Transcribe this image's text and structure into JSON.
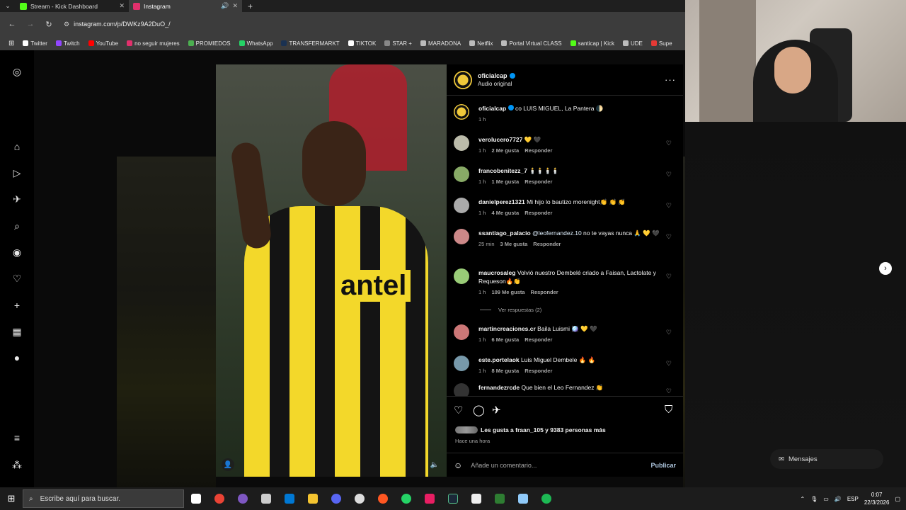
{
  "browser": {
    "tabs": [
      {
        "title": "Stream - Kick Dashboard",
        "color": "#53fc18"
      },
      {
        "title": "Instagram",
        "color": "#e1306c"
      }
    ],
    "url": "instagram.com/p/DWKz9A2DuO_/",
    "bookmarks": [
      {
        "label": "Twitter",
        "color": "#ffffff"
      },
      {
        "label": "Twitch",
        "color": "#9146ff"
      },
      {
        "label": "YouTube",
        "color": "#ff0000"
      },
      {
        "label": "no seguir mujeres",
        "color": "#e1306c"
      },
      {
        "label": "PROMIEDOS",
        "color": "#4caf50"
      },
      {
        "label": "WhatsApp",
        "color": "#25d366"
      },
      {
        "label": "TRANSFERMARKT",
        "color": "#1a3151"
      },
      {
        "label": "TIKTOK",
        "color": "#ffffff"
      },
      {
        "label": "STAR +",
        "color": "#888888"
      },
      {
        "label": "MARADONA",
        "color": "#bbbbbb"
      },
      {
        "label": "Netflix",
        "color": "#bbbbbb"
      },
      {
        "label": "Portal Virtual CLASS",
        "color": "#bbbbbb"
      },
      {
        "label": "santicap | Kick",
        "color": "#53fc18"
      },
      {
        "label": "UDE",
        "color": "#bbbbbb"
      },
      {
        "label": "Supe",
        "color": "#e53935"
      }
    ]
  },
  "post": {
    "header": {
      "username": "oficialcap",
      "subtitle": "Audio original"
    },
    "caption": {
      "username": "oficialcap",
      "text": "co LUIS MIGUEL, La Pantera 🌓",
      "time": "1 h"
    },
    "comments": [
      {
        "user": "verolucero7727",
        "text": "💛 🖤",
        "time": "1 h",
        "likes": "2 Me gusta",
        "reply": "Responder",
        "avatar": "#bba"
      },
      {
        "user": "francobenitezz_7",
        "text": "🕯️🕯️🕯️🕯️",
        "time": "1 h",
        "likes": "1 Me gusta",
        "reply": "Responder",
        "avatar": "#8a6"
      },
      {
        "user": "danielperez1321",
        "text": "Mi hijo lo bautizo morenight👏 👏 👏",
        "time": "1 h",
        "likes": "4 Me gusta",
        "reply": "Responder",
        "avatar": "#aaa"
      },
      {
        "user": "ssantiago_palacio",
        "mention": "@leofernandez.10",
        "text": "no te vayas nunca 🙏 💛 🖤",
        "time": "25 min",
        "likes": "3 Me gusta",
        "reply": "Responder",
        "avatar": "#c88"
      },
      {
        "user": "maucrosaleg",
        "text": "Volvió nuestro Dembelé criado a Faisan, Lactolate y Requeson🔥👏",
        "time": "1 h",
        "likes": "109 Me gusta",
        "reply": "Responder",
        "avatar": "#9c7",
        "view_replies": "Ver respuestas (2)"
      },
      {
        "user": "martincreaciones.cr",
        "text": "Baila Luismi 🪩 💛 🖤",
        "time": "1 h",
        "likes": "6 Me gusta",
        "reply": "Responder",
        "avatar": "#c77"
      },
      {
        "user": "este.portelaok",
        "text": "Luis Miguel Dembele 🔥 🔥",
        "time": "1 h",
        "likes": "8 Me gusta",
        "reply": "Responder",
        "avatar": "#79a"
      },
      {
        "user": "fernandezrcde",
        "text": "Que bien el Leo Fernandez 👏",
        "time": "",
        "likes": "",
        "reply": "",
        "avatar": "#333"
      }
    ],
    "likes_text": "Les gusta a fraan_105 y 9383 personas más",
    "posted": "Hace una hora",
    "comment_placeholder": "Añade un comentario...",
    "publish": "Publicar",
    "image_text": "antel"
  },
  "overlay": {
    "messages": "Mensajes"
  },
  "taskbar": {
    "search_placeholder": "Escribe aquí para buscar.",
    "lang": "ESP",
    "time": "0:07",
    "date": "22/3/2026",
    "apps": [
      "#ffffff",
      "#ea4335",
      "#7e57c2",
      "#cccccc",
      "#0078d4",
      "#f4c430",
      "#5865f2",
      "#dddddd",
      "#ff5722",
      "#25d366",
      "#e91e63",
      "#1b2838",
      "#eeeeee",
      "#2e7d32",
      "#90caf9",
      "#1db954"
    ]
  }
}
